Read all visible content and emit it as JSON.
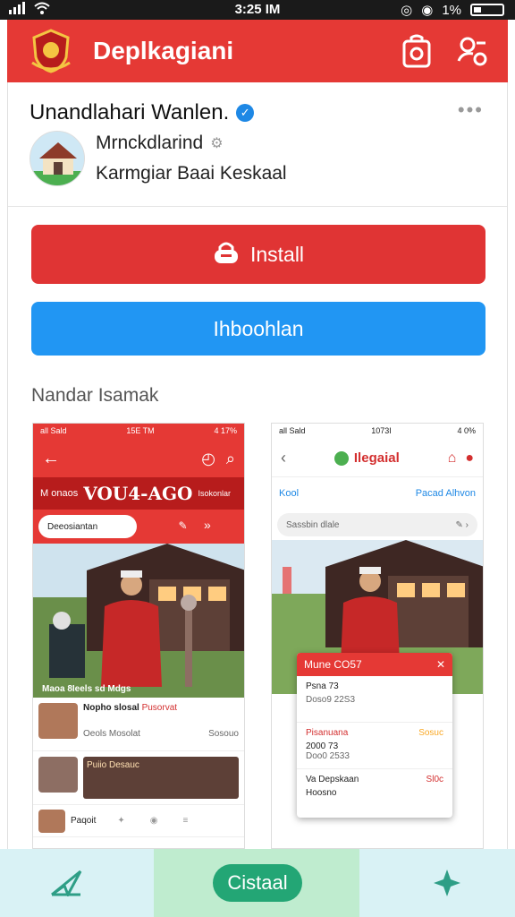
{
  "status_bar": {
    "time": "3:25 IM",
    "battery": "1%"
  },
  "app_bar": {
    "title": "Deplkagiani"
  },
  "developer": {
    "name": "Unandlahari Wanlen.",
    "more": "•••"
  },
  "publisher": {
    "name": "Mrnckdlarind",
    "subtitle": "Karmgiar Baai Keskaal"
  },
  "buttons": {
    "install": "Install",
    "secondary": "Ihboohlan"
  },
  "section": {
    "title": "Nandar Isamak"
  },
  "screenshot_left": {
    "status_left": "all Sald",
    "status_time": "15E TM",
    "status_right": "4 17%",
    "banner_text": "M onaos",
    "banner_big": "VOU4-AGO",
    "banner_right": "Isokonlar",
    "search_placeholder": "Deeosiantan",
    "caption": "Maoa 8Ieels sd Mdgs",
    "rows": [
      {
        "title": "Nopho slosal",
        "title_right": "Pusorvat",
        "sub": "Oeols Mosolat",
        "sub_right": "Sosouo"
      },
      {
        "title": "Puiio Desauc",
        "title_right": "",
        "sub": "",
        "sub_right": ""
      },
      {
        "title": "Paqoit",
        "title_right": "",
        "sub": "",
        "sub_right": ""
      }
    ]
  },
  "screenshot_right": {
    "status_left": "all Sald",
    "status_time": "1073I",
    "status_right": "4 0%",
    "title": "Ilegaial",
    "tab_left": "Kool",
    "tab_right": "Pacad Alhvon",
    "search_placeholder": "Sassbin dlale",
    "popup": {
      "title": "Mune CO57",
      "rows": [
        {
          "title": "Psna 73",
          "sub": "Doso9 22S3",
          "right": ""
        },
        {
          "title": "Pisanuana",
          "sub": "2000 73",
          "sub2": "Doo0 2533",
          "right": "Sosuc"
        },
        {
          "title": "Va Depskaan",
          "sub": "Hoosno",
          "right": "Sl0c"
        }
      ]
    }
  },
  "bottom_bar": {
    "center_label": "Cistaal"
  },
  "colors": {
    "primary_red": "#e53935",
    "install_red": "#e03434",
    "blue": "#2196f3",
    "green": "#23a675"
  }
}
